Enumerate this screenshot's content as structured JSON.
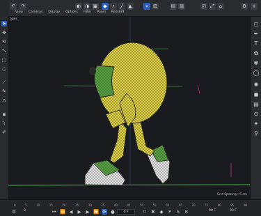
{
  "viewport": {
    "label": "ages",
    "grid_spacing": "Grid Spacing : 5 cm"
  },
  "menu": [
    "View",
    "Cameras",
    "Display",
    "Options",
    "Filter",
    "Panel",
    "Redshift"
  ],
  "timeline": {
    "ruler_ticks": [
      "0",
      "5",
      "10",
      "15",
      "20",
      "25",
      "30",
      "35",
      "40",
      "45",
      "50",
      "55",
      "60",
      "65",
      "70",
      "75",
      "80",
      "85",
      "90"
    ],
    "current_frame": "0 F",
    "left_frame": "0",
    "right_frame": "90 F",
    "end_frame": "90 F"
  },
  "colors": {
    "accent": "#2b5fbf",
    "mesh_yellow": "#e6d84a",
    "mesh_green": "#5aa845",
    "grid_green": "#3fbf4a"
  },
  "icons": {
    "left": [
      "cursor-icon",
      "move-icon",
      "rotate-icon",
      "scale-icon",
      "select-icon",
      "live-select-icon",
      "knife-icon",
      "brush-icon",
      "magnet-icon",
      "paint-icon",
      "eyedropper-icon",
      "poly-pen-icon"
    ],
    "right": [
      "cube-icon",
      "pen-icon",
      "text-icon",
      "cloner-icon",
      "deformer-icon",
      "sphere-icon",
      "light-icon",
      "camera-icon",
      "tag-icon",
      "render-icon",
      "field-icon",
      "marker-icon"
    ]
  }
}
